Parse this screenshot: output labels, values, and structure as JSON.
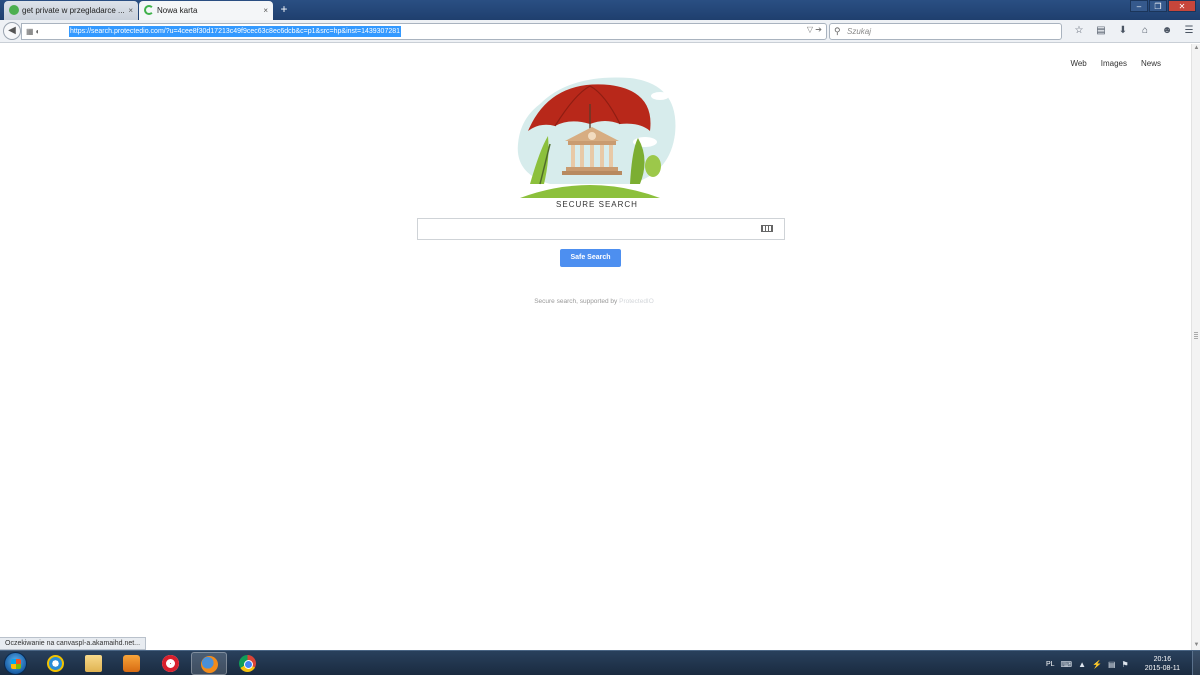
{
  "browser": {
    "tabs": [
      {
        "label": "get private w przegladarce ...",
        "active": false
      },
      {
        "label": "Nowa karta",
        "active": true
      }
    ],
    "new_tab_symbol": "+",
    "tab_close_symbol": "×",
    "url": "https://search.protectedio.com/?u=4cee8f30d17213c49f9cec63c8ec6dcb&c=p1&src=hp&inst=1439307281",
    "search_placeholder": "Szukaj",
    "toolbar_icons": [
      "star-icon",
      "reading-list-icon",
      "download-icon",
      "home-icon",
      "chat-icon",
      "menu-icon"
    ],
    "window_controls": [
      "minimize",
      "maximize",
      "close"
    ]
  },
  "page": {
    "top_nav": [
      "Web",
      "Images",
      "News"
    ],
    "brand_text": "SECURE SEARCH",
    "search_input_value": "",
    "search_button_label": "Safe Search",
    "footer_text": "Secure search, supported by ",
    "footer_brand": "ProtectedIO",
    "accent_color": "#4d8ff0"
  },
  "status_text": "Oczekiwanie na canvaspl-a.akamaihd.net...",
  "taskbar": {
    "apps": [
      "internet-explorer",
      "file-explorer",
      "media-player",
      "opera",
      "firefox",
      "chrome"
    ],
    "language": "PL",
    "clock_time": "20:16",
    "clock_date": "2015-08-11"
  }
}
